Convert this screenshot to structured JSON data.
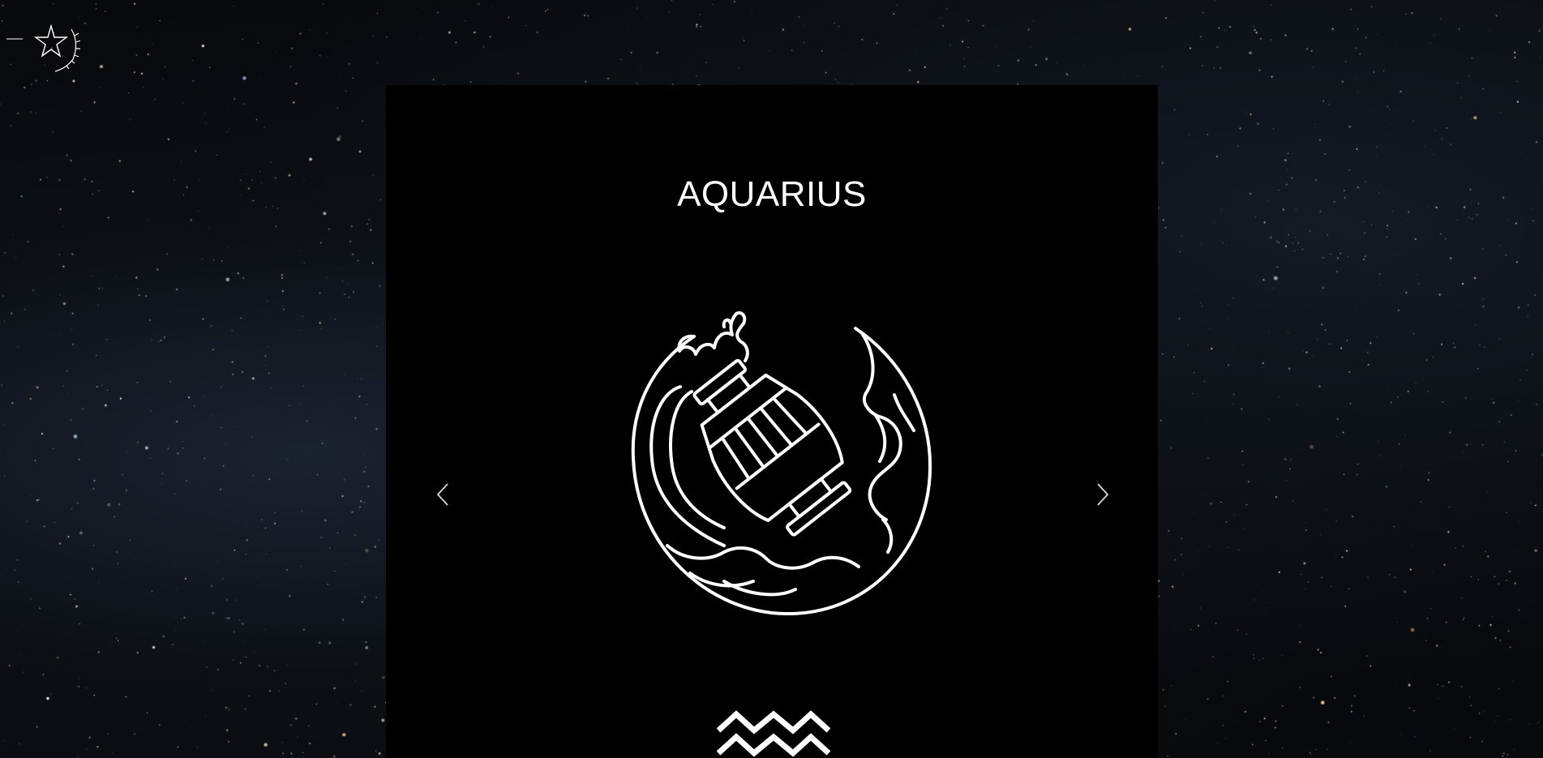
{
  "header": {
    "logo_icon": "crescent-moon-star-laurel-logo"
  },
  "carousel": {
    "title": "AQUARIUS",
    "emblem_icon": "aquarius-water-bearer-icon",
    "glyph_icon": "aquarius-symbol-icon",
    "prev_icon": "chevron-left-icon",
    "next_icon": "chevron-right-icon"
  },
  "colors": {
    "background": "#07090c",
    "card": "#000000",
    "foreground": "#ffffff"
  }
}
